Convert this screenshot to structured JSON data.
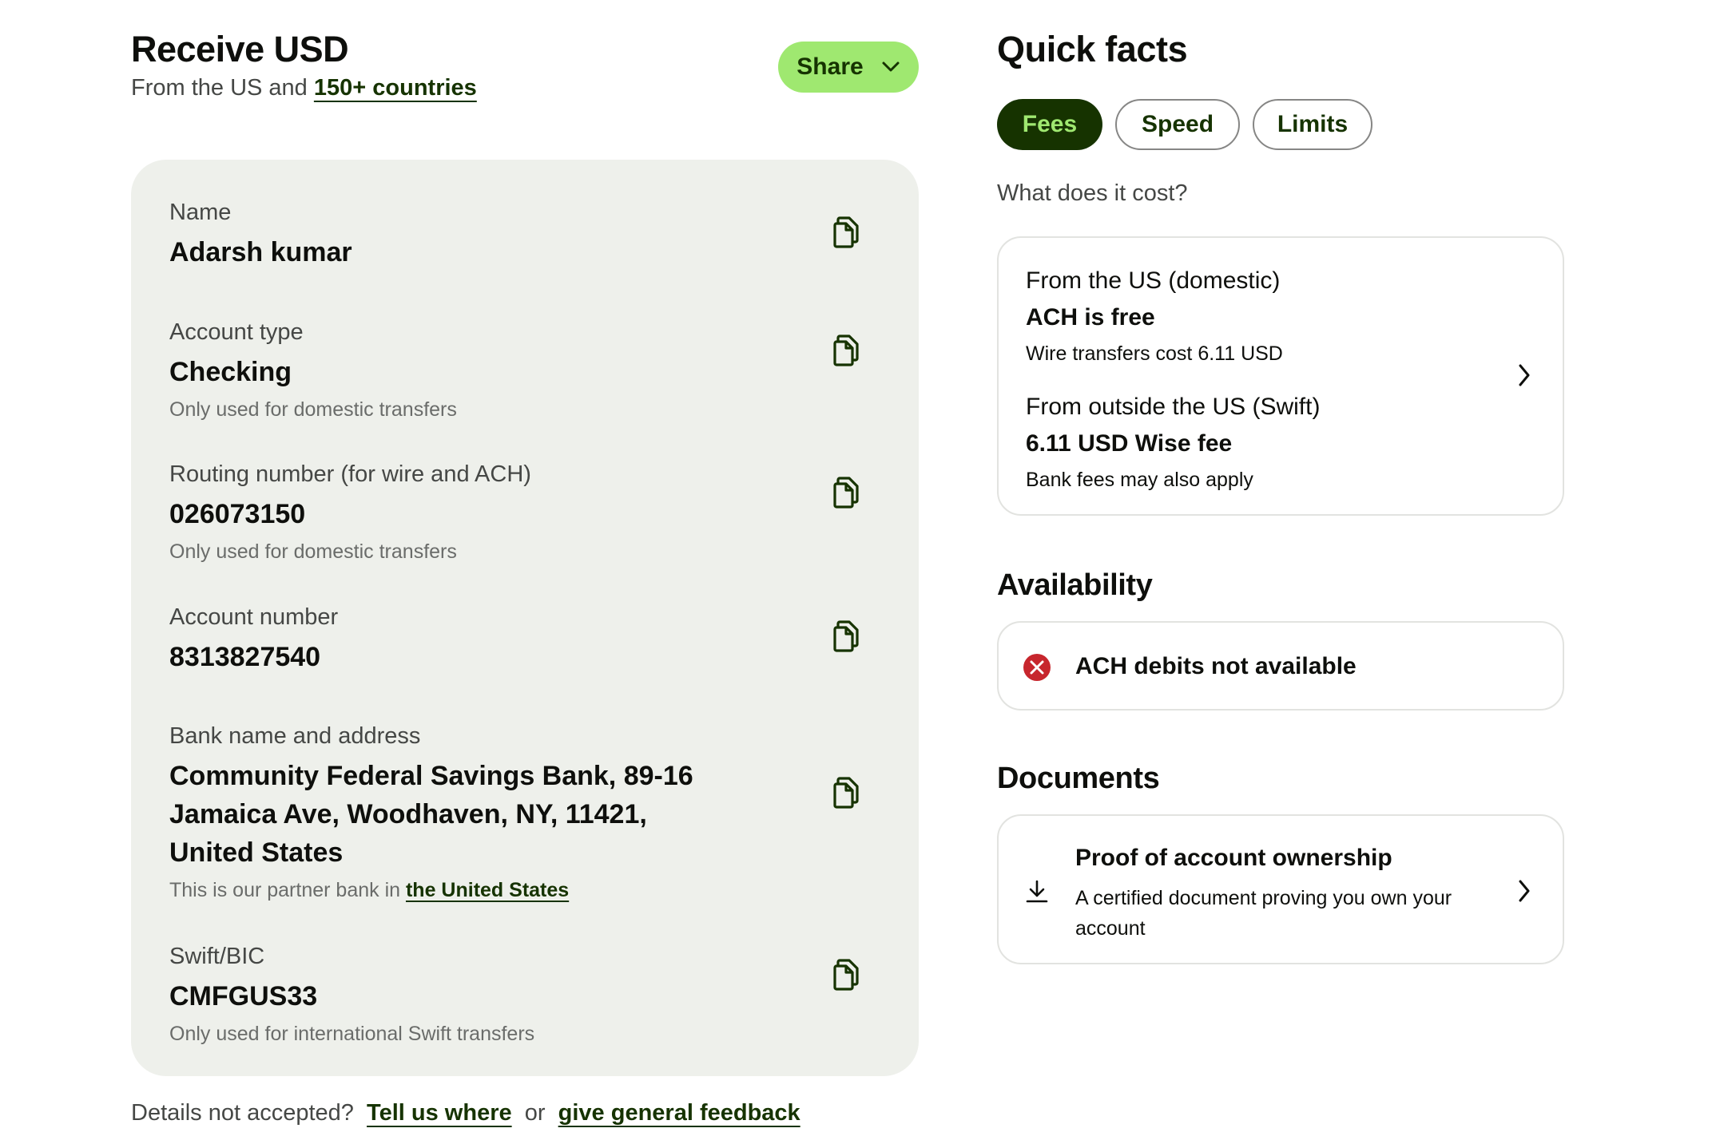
{
  "header": {
    "title": "Receive USD",
    "subtitle_prefix": "From the US and",
    "subtitle_link": "150+ countries",
    "share_label": "Share"
  },
  "details": [
    {
      "label": "Name",
      "value": "Adarsh kumar",
      "note": ""
    },
    {
      "label": "Account type",
      "value": "Checking",
      "note": "Only used for domestic transfers"
    },
    {
      "label": "Routing number (for wire and ACH)",
      "value": "026073150",
      "note": "Only used for domestic transfers"
    },
    {
      "label": "Account number",
      "value": "8313827540",
      "note": ""
    },
    {
      "label": "Bank name and address",
      "value": "Community Federal Savings Bank, 89-16 Jamaica Ave, Woodhaven, NY, 11421, United States",
      "note_prefix": "This is our partner bank in",
      "note_link": "the United States"
    },
    {
      "label": "Swift/BIC",
      "value": "CMFGUS33",
      "note": "Only used for international Swift transfers"
    }
  ],
  "footer": {
    "prefix": "Details not accepted?",
    "link1": "Tell us where",
    "middle": "or",
    "link2": "give general feedback"
  },
  "quick_facts": {
    "title": "Quick facts",
    "tabs": [
      {
        "label": "Fees",
        "active": true
      },
      {
        "label": "Speed",
        "active": false
      },
      {
        "label": "Limits",
        "active": false
      }
    ],
    "question": "What does it cost?",
    "fees": {
      "domestic_heading": "From the US (domestic)",
      "domestic_main": "ACH is free",
      "domestic_sub": "Wire transfers cost 6.11 USD",
      "intl_heading": "From outside the US (Swift)",
      "intl_main": "6.11 USD Wise fee",
      "intl_sub": "Bank fees may also apply"
    }
  },
  "availability": {
    "title": "Availability",
    "item": "ACH debits not available",
    "status_color": "#c7262d"
  },
  "documents": {
    "title": "Documents",
    "item_title": "Proof of account ownership",
    "item_desc": "A certified document proving you own your account"
  },
  "colors": {
    "accent": "#9fe870",
    "forest": "#163300",
    "card_bg": "#eef0eb",
    "error": "#c7262d"
  },
  "icons": {
    "copy": "copy-icon",
    "chevron_down": "chevron-down-icon",
    "chevron_right": "chevron-right-icon",
    "error": "error-circle-icon",
    "download": "download-icon"
  }
}
